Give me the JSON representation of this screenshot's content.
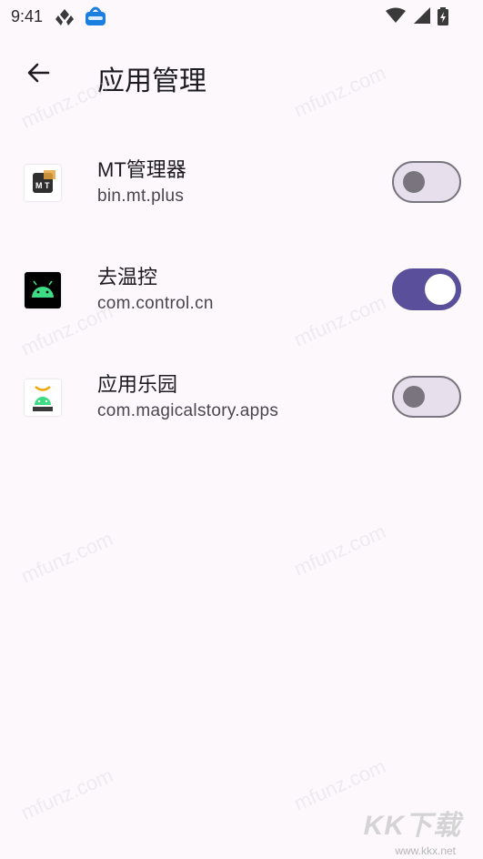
{
  "status_bar": {
    "time": "9:41",
    "icons_left": [
      "diamond-status-icon",
      "app-notification-icon"
    ],
    "icons_right": [
      "wifi-icon",
      "signal-icon",
      "battery-icon"
    ]
  },
  "app_bar": {
    "back_icon": "arrow-left-icon",
    "title": "应用管理"
  },
  "apps": [
    {
      "name": "MT管理器",
      "package": "bin.mt.plus",
      "icon": "mt-manager-icon",
      "enabled": false
    },
    {
      "name": "去温控",
      "package": "com.control.cn",
      "icon": "android-icon",
      "enabled": true
    },
    {
      "name": "应用乐园",
      "package": "com.magicalstory.apps",
      "icon": "android-app-icon",
      "enabled": false
    }
  ],
  "watermark_text": "mfunz.com",
  "footer": {
    "logo": "KK下载",
    "url": "www.kkx.net"
  },
  "colors": {
    "background": "#fcf8fc",
    "switch_on": "#5a4f9b",
    "switch_off_track": "#e7e0ec",
    "switch_off_outline": "#79747e"
  }
}
